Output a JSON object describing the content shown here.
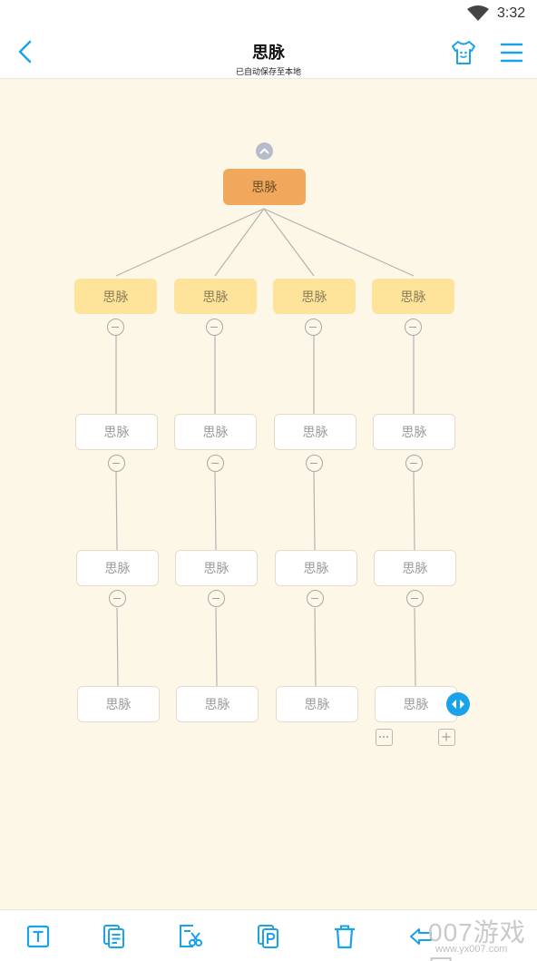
{
  "status_bar": {
    "time": "3:32"
  },
  "header": {
    "title": "思脉",
    "subtitle": "已自动保存至本地"
  },
  "mindmap": {
    "root": "思脉",
    "branches": [
      {
        "label": "思脉",
        "children": [
          "思脉",
          "思脉",
          "思脉"
        ]
      },
      {
        "label": "思脉",
        "children": [
          "思脉",
          "思脉",
          "思脉"
        ]
      },
      {
        "label": "思脉",
        "children": [
          "思脉",
          "思脉",
          "思脉"
        ]
      },
      {
        "label": "思脉",
        "children": [
          "思脉",
          "思脉",
          "思脉"
        ]
      }
    ]
  },
  "colors": {
    "accent": "#1aa3ea",
    "canvas": "#fdf7e7",
    "root_node": "#f0a85c",
    "branch_node": "#fde49a"
  },
  "toolbar": {
    "icons": [
      "text-icon",
      "note-icon",
      "cut-icon",
      "paste-icon",
      "delete-icon",
      "undo-icon"
    ]
  },
  "watermark": {
    "big": "007游戏网",
    "small": "www.yx007.com"
  }
}
